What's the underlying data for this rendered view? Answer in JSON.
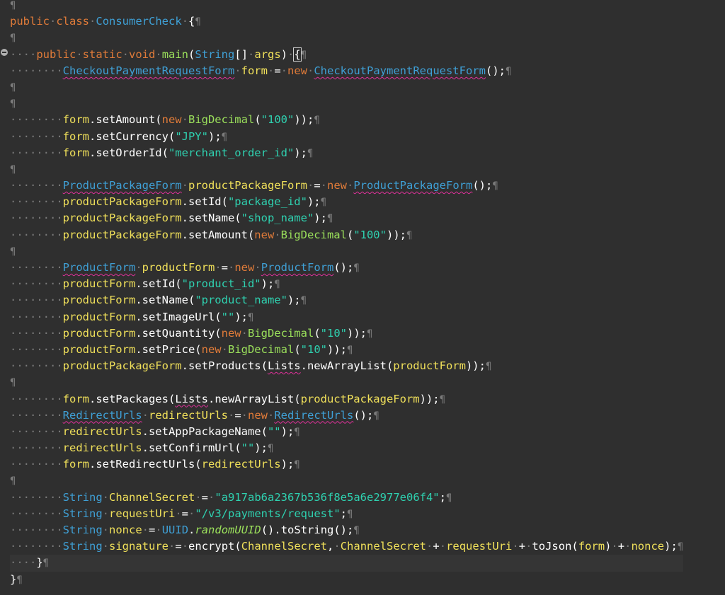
{
  "editor": {
    "language": "Java",
    "current_line": 34,
    "colors": {
      "background": "#2f2f2f",
      "keyword": "#e07b39",
      "type": "#3fa0d6",
      "string": "#2fd1b0",
      "local_variable": "#f0e05a",
      "method_name": "#9be05b",
      "whitespace_marker": "#7a7a7a",
      "error_underline": "#e0309a"
    },
    "lines": [
      [],
      [
        [
          "kw",
          "public"
        ],
        [
          "ws",
          "·"
        ],
        [
          "kw",
          "class"
        ],
        [
          "ws",
          "·"
        ],
        [
          "type",
          "ConsumerCheck"
        ],
        [
          "ws",
          "·"
        ],
        [
          "txt",
          "{"
        ]
      ],
      [],
      [
        [
          "ws",
          "····"
        ],
        [
          "kw",
          "public"
        ],
        [
          "ws",
          "·"
        ],
        [
          "kw",
          "static"
        ],
        [
          "ws",
          "·"
        ],
        [
          "kw",
          "void"
        ],
        [
          "ws",
          "·"
        ],
        [
          "mth",
          "main"
        ],
        [
          "txt",
          "("
        ],
        [
          "type",
          "String"
        ],
        [
          "txt",
          "[]"
        ],
        [
          "ws",
          "·"
        ],
        [
          "fld",
          "args"
        ],
        [
          "txt",
          ")"
        ],
        [
          "ws",
          "·"
        ],
        [
          "brc",
          "{"
        ]
      ],
      [
        [
          "ws",
          "········"
        ],
        [
          "type err",
          "CheckoutPaymentRequestForm"
        ],
        [
          "ws",
          "·"
        ],
        [
          "fld",
          "form"
        ],
        [
          "ws",
          "·"
        ],
        [
          "txt",
          "="
        ],
        [
          "ws",
          "·"
        ],
        [
          "kw",
          "new"
        ],
        [
          "ws",
          "·"
        ],
        [
          "type err",
          "CheckoutPaymentRequestForm"
        ],
        [
          "txt",
          "();"
        ]
      ],
      [],
      [],
      [
        [
          "ws",
          "········"
        ],
        [
          "fld",
          "form"
        ],
        [
          "txt",
          ".setAmount("
        ],
        [
          "kw",
          "new"
        ],
        [
          "ws",
          "·"
        ],
        [
          "mth",
          "BigDecimal"
        ],
        [
          "txt",
          "("
        ],
        [
          "strg",
          "\"100\""
        ],
        [
          "txt",
          "));"
        ]
      ],
      [
        [
          "ws",
          "········"
        ],
        [
          "fld",
          "form"
        ],
        [
          "txt",
          ".setCurrency("
        ],
        [
          "strg",
          "\"JPY\""
        ],
        [
          "txt",
          ");"
        ]
      ],
      [
        [
          "ws",
          "········"
        ],
        [
          "fld",
          "form"
        ],
        [
          "txt",
          ".setOrderId("
        ],
        [
          "strg",
          "\"merchant_order_id\""
        ],
        [
          "txt",
          ");"
        ]
      ],
      [],
      [
        [
          "ws",
          "········"
        ],
        [
          "type err",
          "ProductPackageForm"
        ],
        [
          "ws",
          "·"
        ],
        [
          "fld",
          "productPackageForm"
        ],
        [
          "ws",
          "·"
        ],
        [
          "txt",
          "="
        ],
        [
          "ws",
          "·"
        ],
        [
          "kw",
          "new"
        ],
        [
          "ws",
          "·"
        ],
        [
          "type err",
          "ProductPackageForm"
        ],
        [
          "txt",
          "();"
        ]
      ],
      [
        [
          "ws",
          "········"
        ],
        [
          "fld",
          "productPackageForm"
        ],
        [
          "txt",
          ".setId("
        ],
        [
          "strg",
          "\"package_id\""
        ],
        [
          "txt",
          ");"
        ]
      ],
      [
        [
          "ws",
          "········"
        ],
        [
          "fld",
          "productPackageForm"
        ],
        [
          "txt",
          ".setName("
        ],
        [
          "strg",
          "\"shop_name\""
        ],
        [
          "txt",
          ");"
        ]
      ],
      [
        [
          "ws",
          "········"
        ],
        [
          "fld",
          "productPackageForm"
        ],
        [
          "txt",
          ".setAmount("
        ],
        [
          "kw",
          "new"
        ],
        [
          "ws",
          "·"
        ],
        [
          "mth",
          "BigDecimal"
        ],
        [
          "txt",
          "("
        ],
        [
          "strg",
          "\"100\""
        ],
        [
          "txt",
          "));"
        ]
      ],
      [],
      [
        [
          "ws",
          "········"
        ],
        [
          "type err",
          "ProductForm"
        ],
        [
          "ws",
          "·"
        ],
        [
          "fld",
          "productForm"
        ],
        [
          "ws",
          "·"
        ],
        [
          "txt",
          "="
        ],
        [
          "ws",
          "·"
        ],
        [
          "kw",
          "new"
        ],
        [
          "ws",
          "·"
        ],
        [
          "type err",
          "ProductForm"
        ],
        [
          "txt",
          "();"
        ]
      ],
      [
        [
          "ws",
          "········"
        ],
        [
          "fld",
          "productForm"
        ],
        [
          "txt",
          ".setId("
        ],
        [
          "strg",
          "\"product_id\""
        ],
        [
          "txt",
          ");"
        ]
      ],
      [
        [
          "ws",
          "········"
        ],
        [
          "fld",
          "productForm"
        ],
        [
          "txt",
          ".setName("
        ],
        [
          "strg",
          "\"product_name\""
        ],
        [
          "txt",
          ");"
        ]
      ],
      [
        [
          "ws",
          "········"
        ],
        [
          "fld",
          "productForm"
        ],
        [
          "txt",
          ".setImageUrl("
        ],
        [
          "strg",
          "\"\""
        ],
        [
          "txt",
          ");"
        ]
      ],
      [
        [
          "ws",
          "········"
        ],
        [
          "fld",
          "productForm"
        ],
        [
          "txt",
          ".setQuantity("
        ],
        [
          "kw",
          "new"
        ],
        [
          "ws",
          "·"
        ],
        [
          "mth",
          "BigDecimal"
        ],
        [
          "txt",
          "("
        ],
        [
          "strg",
          "\"10\""
        ],
        [
          "txt",
          "));"
        ]
      ],
      [
        [
          "ws",
          "········"
        ],
        [
          "fld",
          "productForm"
        ],
        [
          "txt",
          ".setPrice("
        ],
        [
          "kw",
          "new"
        ],
        [
          "ws",
          "·"
        ],
        [
          "mth",
          "BigDecimal"
        ],
        [
          "txt",
          "("
        ],
        [
          "strg",
          "\"10\""
        ],
        [
          "txt",
          "));"
        ]
      ],
      [
        [
          "ws",
          "········"
        ],
        [
          "fld",
          "productPackageForm"
        ],
        [
          "txt",
          ".setProducts("
        ],
        [
          "txt err",
          "Lists"
        ],
        [
          "txt",
          ".newArrayList("
        ],
        [
          "fld",
          "productForm"
        ],
        [
          "txt",
          "));"
        ]
      ],
      [],
      [
        [
          "ws",
          "········"
        ],
        [
          "fld",
          "form"
        ],
        [
          "txt",
          ".setPackages("
        ],
        [
          "txt err",
          "Lists"
        ],
        [
          "txt",
          ".newArrayList("
        ],
        [
          "fld",
          "productPackageForm"
        ],
        [
          "txt",
          "));"
        ]
      ],
      [
        [
          "ws",
          "········"
        ],
        [
          "type err",
          "RedirectUrls"
        ],
        [
          "ws",
          "·"
        ],
        [
          "fld",
          "redirectUrls"
        ],
        [
          "ws",
          "·"
        ],
        [
          "txt",
          "="
        ],
        [
          "ws",
          "·"
        ],
        [
          "kw",
          "new"
        ],
        [
          "ws",
          "·"
        ],
        [
          "type err",
          "RedirectUrls"
        ],
        [
          "txt",
          "();"
        ]
      ],
      [
        [
          "ws",
          "········"
        ],
        [
          "fld",
          "redirectUrls"
        ],
        [
          "txt",
          ".setAppPackageName("
        ],
        [
          "strg",
          "\"\""
        ],
        [
          "txt",
          ");"
        ]
      ],
      [
        [
          "ws",
          "········"
        ],
        [
          "fld",
          "redirectUrls"
        ],
        [
          "txt",
          ".setConfirmUrl("
        ],
        [
          "strg",
          "\"\""
        ],
        [
          "txt",
          ");"
        ]
      ],
      [
        [
          "ws",
          "········"
        ],
        [
          "fld",
          "form"
        ],
        [
          "txt",
          ".setRedirectUrls("
        ],
        [
          "fld",
          "redirectUrls"
        ],
        [
          "txt",
          ");"
        ]
      ],
      [],
      [
        [
          "ws",
          "········"
        ],
        [
          "type",
          "String"
        ],
        [
          "ws",
          "·"
        ],
        [
          "fld",
          "ChannelSecret"
        ],
        [
          "ws",
          "·"
        ],
        [
          "txt",
          "="
        ],
        [
          "ws",
          "·"
        ],
        [
          "strg",
          "\"a917ab6a2367b536f8e5a6e2977e06f4\""
        ],
        [
          "txt",
          ";"
        ]
      ],
      [
        [
          "ws",
          "········"
        ],
        [
          "type",
          "String"
        ],
        [
          "ws",
          "·"
        ],
        [
          "fld",
          "requestUri"
        ],
        [
          "ws",
          "·"
        ],
        [
          "txt",
          "="
        ],
        [
          "ws",
          "·"
        ],
        [
          "strg",
          "\"/v3/payments/request\""
        ],
        [
          "txt",
          ";"
        ]
      ],
      [
        [
          "ws",
          "········"
        ],
        [
          "type",
          "String"
        ],
        [
          "ws",
          "·"
        ],
        [
          "fld",
          "nonce"
        ],
        [
          "ws",
          "·"
        ],
        [
          "txt",
          "="
        ],
        [
          "ws",
          "·"
        ],
        [
          "type",
          "UUID"
        ],
        [
          "txt",
          "."
        ],
        [
          "itl",
          "randomUUID"
        ],
        [
          "txt",
          "().toString();"
        ]
      ],
      [
        [
          "ws",
          "········"
        ],
        [
          "type",
          "String"
        ],
        [
          "ws",
          "·"
        ],
        [
          "fld",
          "signature"
        ],
        [
          "ws",
          "·"
        ],
        [
          "txt",
          "="
        ],
        [
          "ws",
          "·"
        ],
        [
          "txt",
          "encrypt("
        ],
        [
          "fld",
          "ChannelSecret"
        ],
        [
          "txt",
          ","
        ],
        [
          "ws",
          "·"
        ],
        [
          "fld",
          "ChannelSecret"
        ],
        [
          "ws",
          "·"
        ],
        [
          "txt",
          "+"
        ],
        [
          "ws",
          "·"
        ],
        [
          "fld",
          "requestUri"
        ],
        [
          "ws",
          "·"
        ],
        [
          "txt",
          "+"
        ],
        [
          "ws",
          "·"
        ],
        [
          "txt",
          "toJson("
        ],
        [
          "fld",
          "form"
        ],
        [
          "txt",
          ")"
        ],
        [
          "ws",
          "·"
        ],
        [
          "txt",
          "+"
        ],
        [
          "ws",
          "·"
        ],
        [
          "fld",
          "nonce"
        ],
        [
          "txt",
          ");"
        ]
      ],
      [
        [
          "ws",
          "····"
        ],
        [
          "txt",
          "}"
        ]
      ],
      [
        [
          "txt",
          "}"
        ]
      ]
    ],
    "eol_marker": "¶"
  }
}
